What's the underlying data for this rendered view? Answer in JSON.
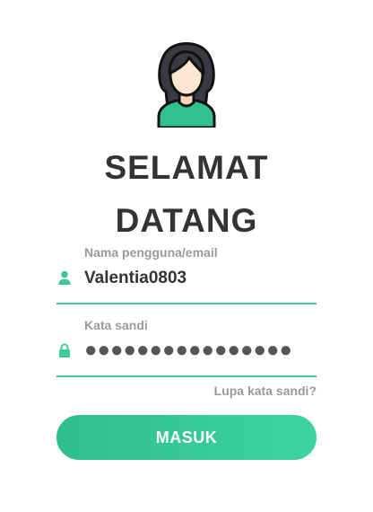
{
  "welcome": {
    "line1": "SELAMAT",
    "line2": "DATANG"
  },
  "username": {
    "label": "Nama pengguna/email",
    "value": "Valentia0803",
    "icon": "user-icon"
  },
  "password": {
    "label": "Kata sandi",
    "value": "●●●●●●●●●●●●●●●●",
    "icon": "lock-icon"
  },
  "forgot_link": "Lupa kata sandi?",
  "submit_label": "MASUK",
  "colors": {
    "accent": "#3cc99a",
    "title": "#333333",
    "label": "#9a9a9a",
    "button_text": "#ffffff"
  }
}
